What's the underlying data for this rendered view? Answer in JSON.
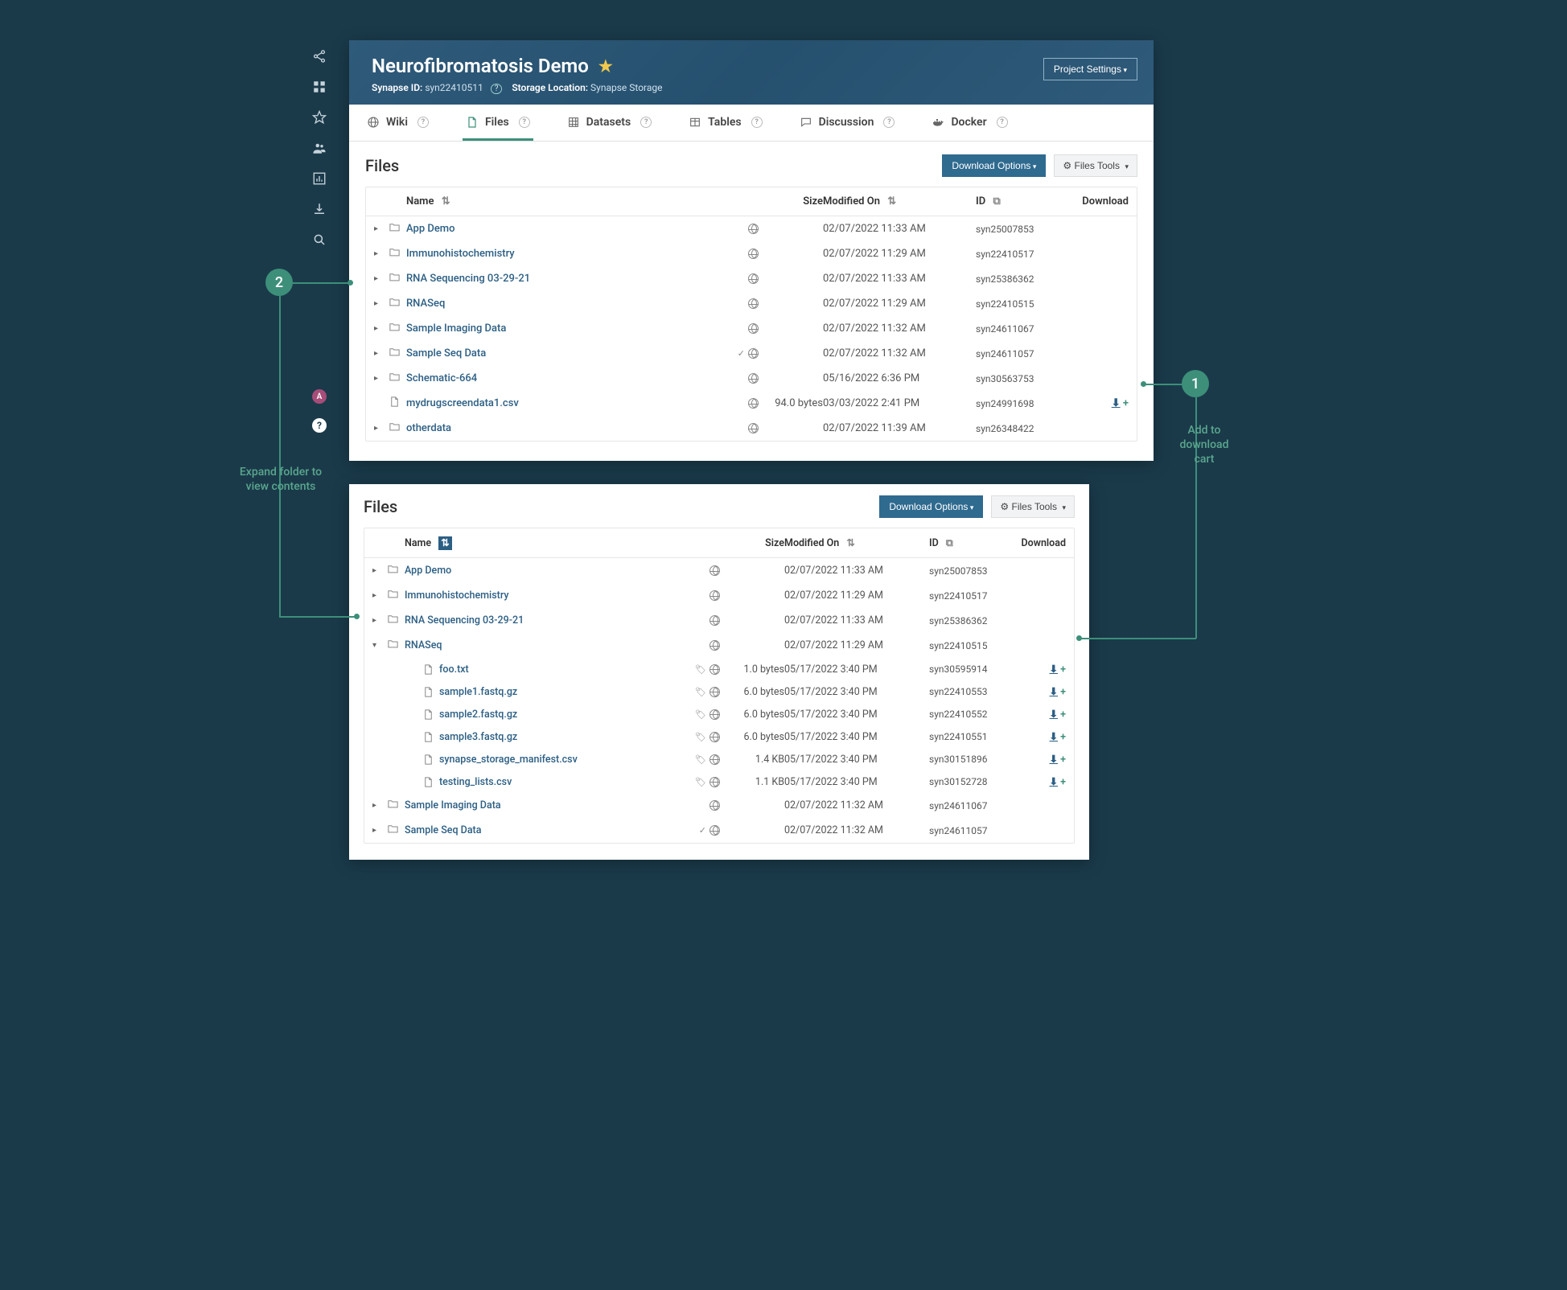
{
  "project": {
    "title": "Neurofibromatosis Demo",
    "synapse_id_label": "Synapse ID:",
    "synapse_id": "syn22410511",
    "storage_label": "Storage Location:",
    "storage_value": "Synapse Storage",
    "settings_label": "Project Settings"
  },
  "tabs": [
    {
      "label": "Wiki",
      "icon": "globe"
    },
    {
      "label": "Files",
      "icon": "file",
      "active": true
    },
    {
      "label": "Datasets",
      "icon": "grid"
    },
    {
      "label": "Tables",
      "icon": "table"
    },
    {
      "label": "Discussion",
      "icon": "chat"
    },
    {
      "label": "Docker",
      "icon": "docker"
    }
  ],
  "files_heading": "Files",
  "download_options_label": "Download Options",
  "files_tools_label": "Files Tools",
  "columns": {
    "name": "Name",
    "size": "Size",
    "modified": "Modified On",
    "id": "ID",
    "download": "Download"
  },
  "panel1_rows": [
    {
      "type": "folder",
      "name": "App Demo",
      "badges": [
        "globe"
      ],
      "size": "",
      "date": "02/07/2022 11:33 AM",
      "id": "syn25007853"
    },
    {
      "type": "folder",
      "name": "Immunohistochemistry",
      "badges": [
        "globe"
      ],
      "size": "",
      "date": "02/07/2022 11:29 AM",
      "id": "syn22410517"
    },
    {
      "type": "folder",
      "name": "RNA Sequencing 03-29-21",
      "badges": [
        "globe"
      ],
      "size": "",
      "date": "02/07/2022 11:33 AM",
      "id": "syn25386362"
    },
    {
      "type": "folder",
      "name": "RNASeq",
      "badges": [
        "globe"
      ],
      "size": "",
      "date": "02/07/2022 11:29 AM",
      "id": "syn22410515"
    },
    {
      "type": "folder",
      "name": "Sample Imaging Data",
      "badges": [
        "globe"
      ],
      "size": "",
      "date": "02/07/2022 11:32 AM",
      "id": "syn24611067"
    },
    {
      "type": "folder",
      "name": "Sample Seq Data",
      "badges": [
        "check",
        "globe"
      ],
      "size": "",
      "date": "02/07/2022 11:32 AM",
      "id": "syn24611057"
    },
    {
      "type": "folder",
      "name": "Schematic-664",
      "badges": [
        "globe"
      ],
      "size": "",
      "date": "05/16/2022 6:36 PM",
      "id": "syn30563753"
    },
    {
      "type": "file",
      "name": "mydrugscreendata1.csv",
      "badges": [
        "globe"
      ],
      "size": "94.0 bytes",
      "date": "03/03/2022 2:41 PM",
      "id": "syn24991698",
      "download": true
    },
    {
      "type": "folder",
      "name": "otherdata",
      "badges": [
        "globe"
      ],
      "size": "",
      "date": "02/07/2022 11:39 AM",
      "id": "syn26348422"
    }
  ],
  "panel2_rows": [
    {
      "type": "folder",
      "name": "App Demo",
      "badges": [
        "globe"
      ],
      "size": "",
      "date": "02/07/2022 11:33 AM",
      "id": "syn25007853"
    },
    {
      "type": "folder",
      "name": "Immunohistochemistry",
      "badges": [
        "globe"
      ],
      "size": "",
      "date": "02/07/2022 11:29 AM",
      "id": "syn22410517"
    },
    {
      "type": "folder",
      "name": "RNA Sequencing 03-29-21",
      "badges": [
        "globe"
      ],
      "size": "",
      "date": "02/07/2022 11:33 AM",
      "id": "syn25386362"
    },
    {
      "type": "folder",
      "name": "RNASeq",
      "expanded": true,
      "badges": [
        "globe"
      ],
      "size": "",
      "date": "02/07/2022 11:29 AM",
      "id": "syn22410515"
    },
    {
      "type": "file",
      "child": true,
      "name": "foo.txt",
      "badges": [
        "tag",
        "globe"
      ],
      "size": "1.0 bytes",
      "date": "05/17/2022 3:40 PM",
      "id": "syn30595914",
      "download": true
    },
    {
      "type": "file",
      "child": true,
      "name": "sample1.fastq.gz",
      "badges": [
        "tag",
        "globe"
      ],
      "size": "6.0 bytes",
      "date": "05/17/2022 3:40 PM",
      "id": "syn22410553",
      "download": true
    },
    {
      "type": "file",
      "child": true,
      "name": "sample2.fastq.gz",
      "badges": [
        "tag",
        "globe"
      ],
      "size": "6.0 bytes",
      "date": "05/17/2022 3:40 PM",
      "id": "syn22410552",
      "download": true
    },
    {
      "type": "file",
      "child": true,
      "name": "sample3.fastq.gz",
      "badges": [
        "tag",
        "globe"
      ],
      "size": "6.0 bytes",
      "date": "05/17/2022 3:40 PM",
      "id": "syn22410551",
      "download": true
    },
    {
      "type": "file",
      "child": true,
      "name": "synapse_storage_manifest.csv",
      "badges": [
        "tag",
        "globe"
      ],
      "size": "1.4 KB",
      "date": "05/17/2022 3:40 PM",
      "id": "syn30151896",
      "download": true
    },
    {
      "type": "file",
      "child": true,
      "name": "testing_lists.csv",
      "badges": [
        "tag",
        "globe"
      ],
      "size": "1.1 KB",
      "date": "05/17/2022 3:40 PM",
      "id": "syn30152728",
      "download": true
    },
    {
      "type": "folder",
      "name": "Sample Imaging Data",
      "badges": [
        "globe"
      ],
      "size": "",
      "date": "02/07/2022 11:32 AM",
      "id": "syn24611067"
    },
    {
      "type": "folder",
      "name": "Sample Seq Data",
      "badges": [
        "check",
        "globe"
      ],
      "size": "",
      "date": "02/07/2022 11:32 AM",
      "id": "syn24611057"
    }
  ],
  "callouts": {
    "c1": {
      "num": "1",
      "label": "Add to\ndownload\ncart"
    },
    "c2": {
      "num": "2",
      "label": "Expand folder to\nview contents"
    }
  },
  "avatar_letter": "A",
  "gear_prefix": "⚙ "
}
